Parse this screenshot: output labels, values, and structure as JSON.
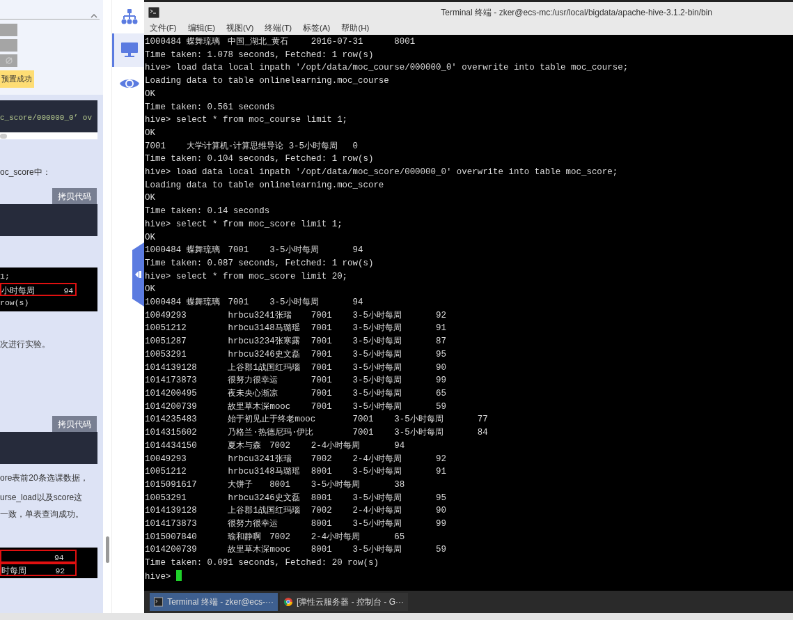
{
  "doc": {
    "blocks": [
      {
        "kind": "card",
        "badge": "预置成功"
      },
      {
        "kind": "code",
        "text": "c_score/000000_0’ ov",
        "scrollbar": true
      },
      {
        "kind": "text",
        "text": "oc_score中："
      },
      {
        "kind": "copy",
        "label": "拷贝代码"
      },
      {
        "kind": "code"
      },
      {
        "kind": "shot",
        "lines": [
          {
            "text": "1;",
            "boxed": false
          },
          {
            "text": "小时每周      94",
            "boxed": true
          },
          {
            "text": "row(s)",
            "boxed": false
          }
        ]
      },
      {
        "kind": "text",
        "text": "次进行实验。"
      },
      {
        "kind": "copy",
        "label": "拷贝代码"
      },
      {
        "kind": "code"
      },
      {
        "kind": "text",
        "text": "ore表前20条选课数据，"
      },
      {
        "kind": "text",
        "text": "urse_load以及score这"
      },
      {
        "kind": "text",
        "text": "一致，单表查询成功。"
      },
      {
        "kind": "shot",
        "lines": [
          {
            "text": "           94",
            "boxed": true
          },
          {
            "text": "时每周      92",
            "boxed": true
          }
        ]
      }
    ]
  },
  "rail": {
    "items": [
      {
        "selected": false
      },
      {
        "selected": true
      },
      {
        "selected": false
      }
    ]
  },
  "terminal": {
    "title": "Terminal 终端 - zker@ecs-mc:/usr/local/bigdata/apache-hive-3.1.2-bin/bin",
    "menu": [
      "文件(F)",
      "编辑(E)",
      "视图(V)",
      "终端(T)",
      "标签(A)",
      "帮助(H)"
    ],
    "lines": [
      "1000484 蝶舞琉璃\t中国_湖北_黄石\t2016-07-31\t8001",
      "Time taken: 1.078 seconds, Fetched: 1 row(s)",
      "hive> load data local inpath '/opt/data/moc_course/000000_0' overwrite into table moc_course;",
      "Loading data to table onlinelearning.moc_course",
      "OK",
      "Time taken: 0.561 seconds",
      "hive> select * from moc_course limit 1;",
      "OK",
      "7001\t大学计算机-计算思维导论 3-5小时每周\t0",
      "Time taken: 0.104 seconds, Fetched: 1 row(s)",
      "hive> load data local inpath '/opt/data/moc_score/000000_0' overwrite into table moc_score;",
      "Loading data to table onlinelearning.moc_score",
      "OK",
      "Time taken: 0.14 seconds",
      "hive> select * from moc_score limit 1;",
      "OK",
      "1000484 蝶舞琉璃\t7001\t3-5小时每周\t94",
      "Time taken: 0.087 seconds, Fetched: 1 row(s)",
      "hive> select * from moc_score limit 20;",
      "OK",
      "1000484 蝶舞琉璃\t7001\t3-5小时每周\t94",
      "10049293\thrbcu3241张瑞\t7001\t3-5小时每周\t92",
      "10051212\thrbcu3148马璐瑶\t7001\t3-5小时每周\t91",
      "10051287\thrbcu3234张寒露\t7001\t3-5小时每周\t87",
      "10053291\thrbcu3246史文磊\t7001\t3-5小时每周\t95",
      "1014139128\t上谷郡1战国红玛瑙\t7001\t3-5小时每周\t90",
      "1014173873\t很努力很幸运\t7001\t3-5小时每周\t99",
      "1014200495\t夜未央心渐凉\t7001\t3-5小时每周\t65",
      "1014200739\t故里草木深mooc\t7001\t3-5小时每周\t59",
      "1014235483\t始于初见止于终老mooc\t7001\t3-5小时每周\t77",
      "1014315602\t乃格兰·热德尼玛·伊比\t7001\t3-5小时每周\t84",
      "1014434150\t夏木与森\t7002\t2-4小时每周\t94",
      "10049293\thrbcu3241张瑞\t7002\t2-4小时每周\t92",
      "10051212\thrbcu3148马璐瑶\t8001\t3-5小时每周\t91",
      "1015091617\t大饼子\t8001\t3-5小时每周\t38",
      "10053291\thrbcu3246史文磊\t8001\t3-5小时每周\t95",
      "1014139128\t上谷郡1战国红玛瑙\t7002\t2-4小时每周\t90",
      "1014173873\t很努力很幸运\t8001\t3-5小时每周\t99",
      "1015007840\t瑜和静啊\t7002\t2-4小时每周\t65",
      "1014200739\t故里草木深mooc\t8001\t3-5小时每周\t59",
      "Time taken: 0.091 seconds, Fetched: 20 row(s)"
    ],
    "prompt": "hive>"
  },
  "taskbar": [
    {
      "label": "Terminal 终端 - zker@ecs-···",
      "selected": true
    },
    {
      "label": "[弹性云服务器 - 控制台 - G···",
      "selected": false
    }
  ]
}
